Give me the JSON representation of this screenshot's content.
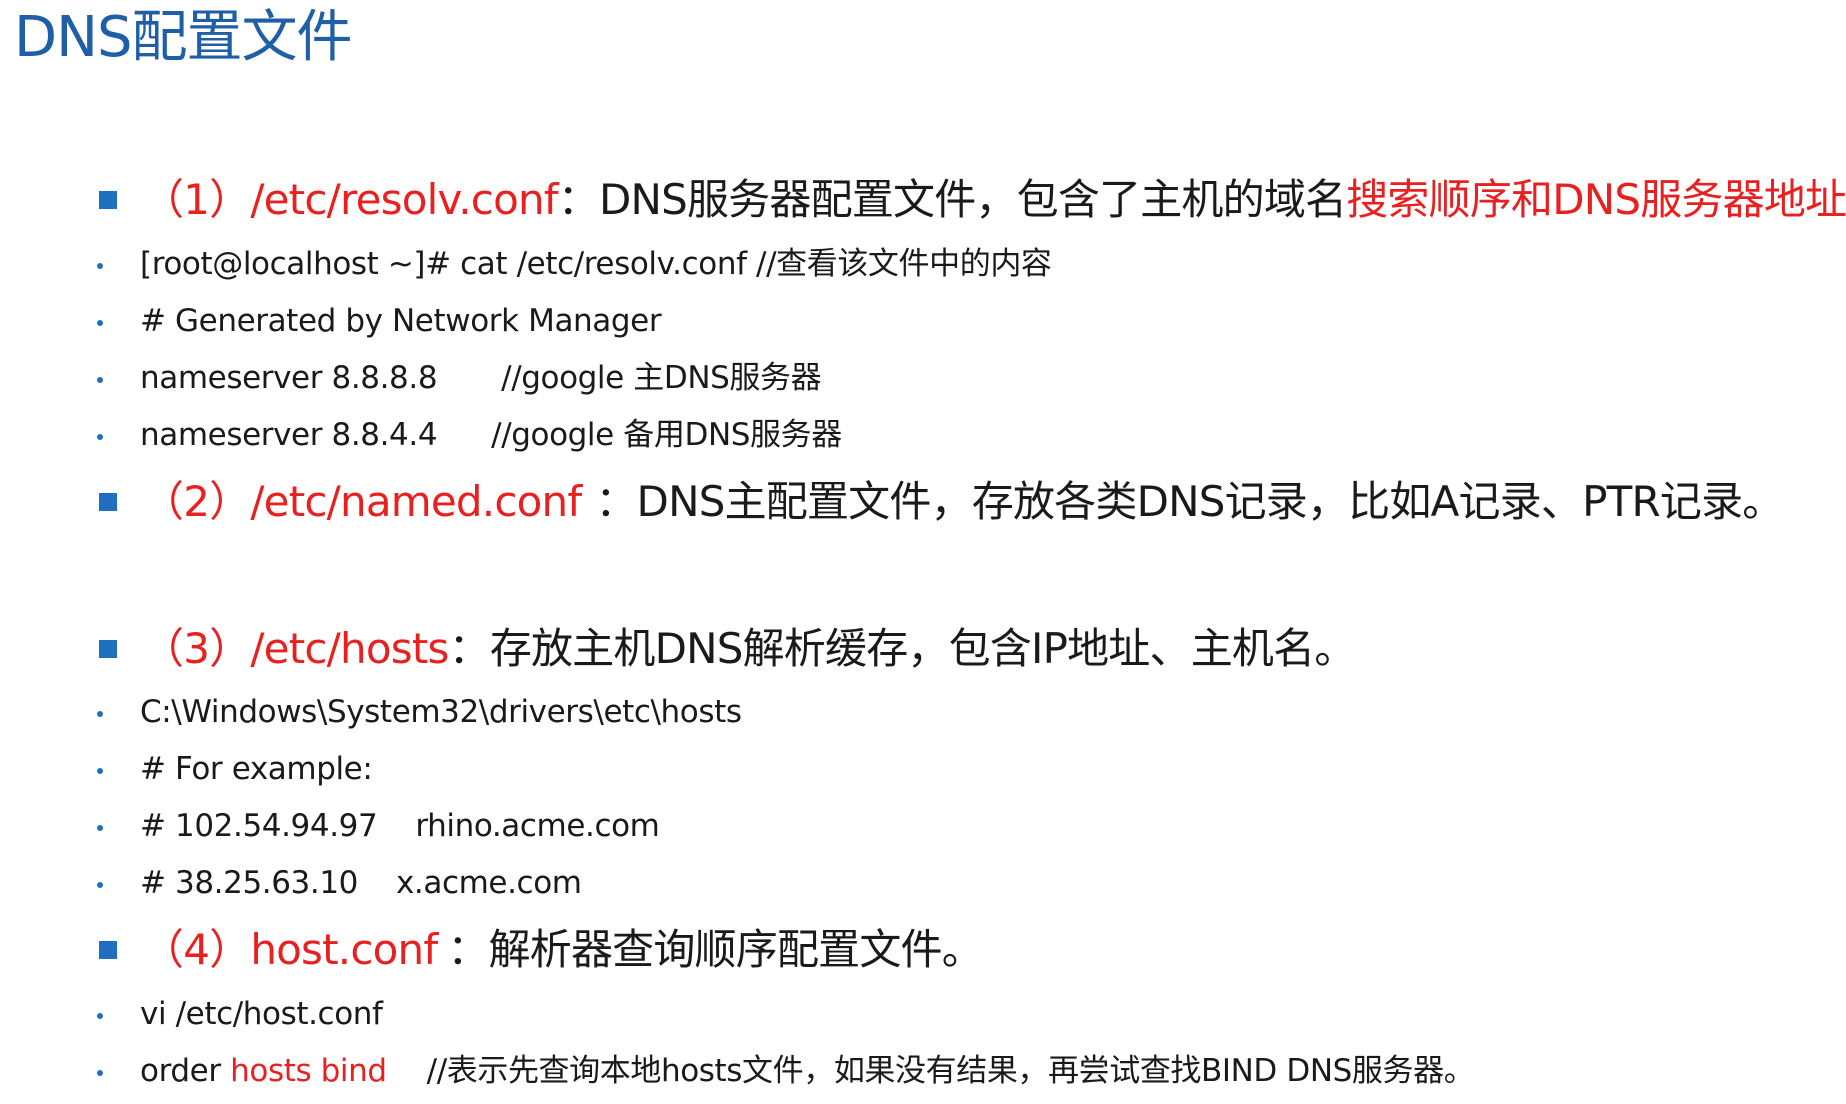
{
  "title": "DNS配置文件",
  "item1": {
    "label": "（1）/etc/resolv.conf",
    "desc": "：DNS服务器配置文件，包含了主机的域名",
    "highlight": "搜索顺序和DNS服务器地址",
    "end": "。"
  },
  "item1_lines": {
    "l1": "[root@localhost ~]# cat /etc/resolv.conf //查看该文件中的内容",
    "l2": "# Generated by Network Manager",
    "l3a": "nameserver 8.8.8.8",
    "l3b": "//google 主DNS服务器",
    "l4a": "nameserver 8.8.4.4",
    "l4b": "//google 备用DNS服务器"
  },
  "item2": {
    "label": "（2）/etc/named.conf",
    "desc": "：DNS主配置文件，存放各类DNS记录，比如A记录、PTR记录。"
  },
  "item3": {
    "label": "（3）/etc/hosts",
    "desc": "：存放主机DNS解析缓存，包含IP地址、主机名。"
  },
  "item3_lines": {
    "l1": "C:\\Windows\\System32\\drivers\\etc\\hosts",
    "l2": "# For example:",
    "l3a": "# 102.54.94.97",
    "l3b": "rhino.acme.com",
    "l4a": "# 38.25.63.10",
    "l4b": "x.acme.com"
  },
  "item4": {
    "label": "（4）host.conf",
    "desc": "：解析器查询顺序配置文件。"
  },
  "item4_lines": {
    "l1": "vi /etc/host.conf",
    "l2a": "order ",
    "l2b": "hosts bind",
    "l2c": "//表示先查询本地hosts文件，如果没有结果，再尝试查找BIND DNS服务器。"
  },
  "colors": {
    "title": "#1f5fa8",
    "bullet": "#1f6fbf",
    "highlight": "#e8201f",
    "text": "#1a1a1a"
  }
}
